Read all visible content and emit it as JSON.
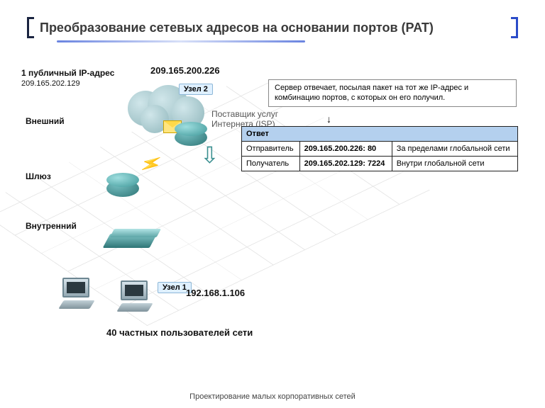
{
  "slide": {
    "title": "Преобразование сетевых адресов на основании портов (PAT)",
    "footer": "Проектирование малых корпоративных сетей"
  },
  "labels": {
    "public_ip_caption": "1 публичный IP-адрес",
    "public_ip_value": "209.165.202.129",
    "external": "Внешний",
    "gateway": "Шлюз",
    "internal": "Внутренний",
    "server_ip": "209.165.200.226",
    "isp": "Поставщик услуг Интернета (ISP)",
    "host2": "Узел 2",
    "host1": "Узел 1",
    "host1_ip": "192.168.1.106",
    "users": "40 частных пользователей сети"
  },
  "callout": "Сервер отвечает, посылая пакет на тот же IP-адрес и комбинацию портов, с которых он его получил.",
  "table": {
    "header": "Ответ",
    "rows": [
      {
        "role": "Отправитель",
        "addr": "209.165.200.226: 80",
        "scope": "За пределами глобальной сети"
      },
      {
        "role": "Получатель",
        "addr": "209.165.202.129: 7224",
        "scope": "Внутри глобальной сети"
      }
    ]
  }
}
